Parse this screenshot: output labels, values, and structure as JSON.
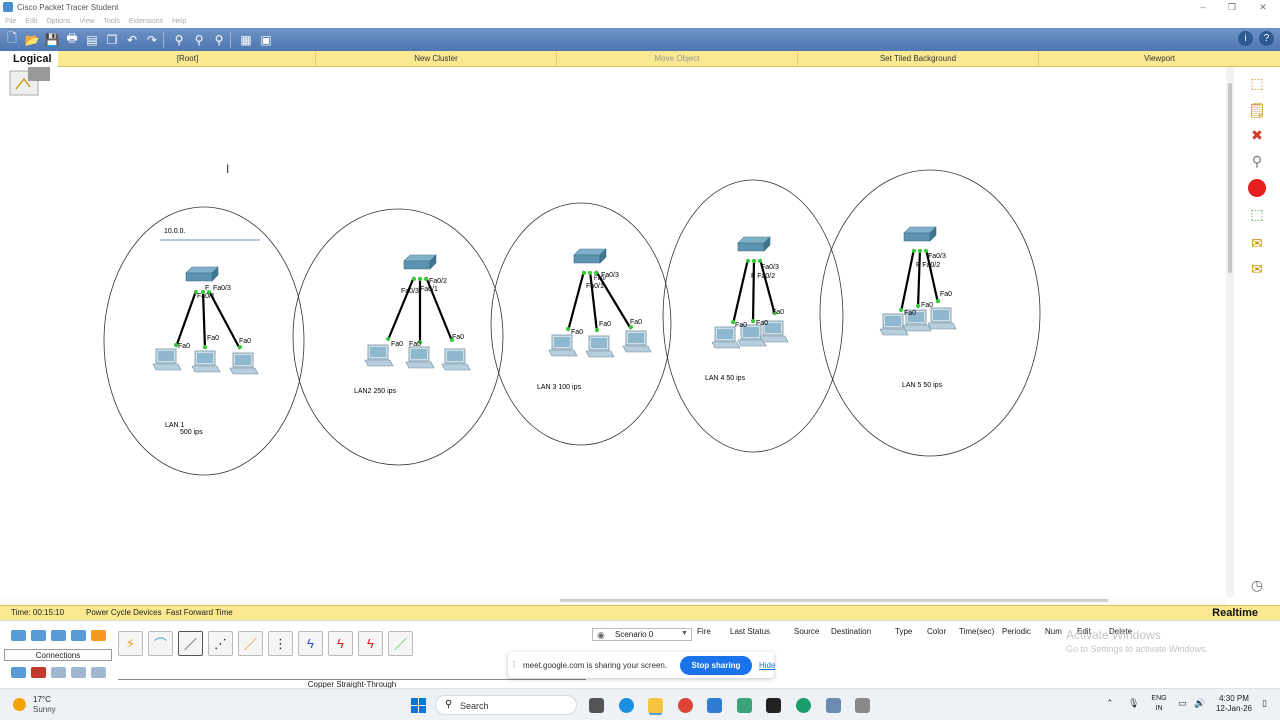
{
  "window": {
    "title": "Cisco Packet Tracer Student",
    "controls": [
      "–",
      "❐",
      "✕"
    ]
  },
  "menu": [
    "File",
    "Edit",
    "Options",
    "View",
    "Tools",
    "Extensions",
    "Help"
  ],
  "workspace_bar": {
    "mode_label": "Logical",
    "items": [
      {
        "label": "[Root]",
        "enabled": true
      },
      {
        "label": "New Cluster",
        "enabled": true
      },
      {
        "label": "Move Object",
        "enabled": false
      },
      {
        "label": "Set Tiled Background",
        "enabled": true
      },
      {
        "label": "Viewport",
        "enabled": true
      }
    ]
  },
  "canvas": {
    "note_input_value": "10.0.0.",
    "lans": [
      {
        "label_line1": "LAN 1",
        "label_line2": "500 ips",
        "switch_ports": [
          "Fa0/3",
          "F",
          "Fa0/1"
        ],
        "pc_ports": [
          "Fa0",
          "Fa0",
          "Fa0"
        ]
      },
      {
        "label_line1": "LAN2  250 ips",
        "label_line2": "",
        "switch_ports": [
          "Fa0/2",
          "Fa0/3",
          "Fa0/1"
        ],
        "pc_ports": [
          "Fa0",
          "Fa0",
          "Fa0"
        ]
      },
      {
        "label_line1": "LAN 3  100 ips",
        "label_line2": "",
        "switch_ports": [
          "Fa0/3",
          "Fa0/",
          "Fa0/1"
        ],
        "pc_ports": [
          "Fa0",
          "Fa0",
          "Fa0"
        ]
      },
      {
        "label_line1": "LAN 4  50 ips",
        "label_line2": "",
        "switch_ports": [
          "Fa0/3",
          "F Fa0/2"
        ],
        "pc_ports": [
          "Fa0",
          "Fa0",
          "Fa0"
        ]
      },
      {
        "label_line1": "LAN 5  50 ips",
        "label_line2": "",
        "switch_ports": [
          "Fa0/3",
          "F Fa0/2"
        ],
        "pc_ports": [
          "Fa0",
          "Fa0",
          "Fa0"
        ]
      }
    ]
  },
  "timebar": {
    "time": "Time: 00:15:10",
    "power_cycle": "Power Cycle Devices",
    "fast_forward": "Fast Forward Time",
    "mode": "Realtime"
  },
  "device_panel": {
    "category_label": "Connections",
    "selected_cable": "Copper Straight-Through",
    "scenario": "Scenario 0",
    "pdu_columns": [
      "Fire",
      "Last Status",
      "Source",
      "Destination",
      "Type",
      "Color",
      "Time(sec)",
      "Periodic",
      "Num",
      "Edit",
      "Delete"
    ],
    "watermark_title": "Activate Windows",
    "watermark_sub": "Go to Settings to activate Windows."
  },
  "meet_banner": {
    "text": "meet.google.com is sharing your screen.",
    "stop_label": "Stop sharing",
    "hide_label": "Hide"
  },
  "taskbar": {
    "weather_temp": "17°C",
    "weather_cond": "Sunny",
    "search_label": "Search",
    "lang_line1": "ENG",
    "lang_line2": "IN",
    "time": "4:30 PM",
    "date": "12-Jan-26"
  }
}
